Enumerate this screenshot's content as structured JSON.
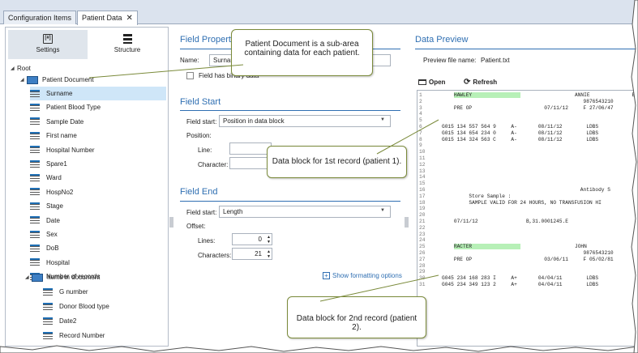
{
  "tabs": [
    {
      "label": "Configuration Items"
    },
    {
      "label": "Patient Data",
      "close": "✕"
    }
  ],
  "left_panel": {
    "settings_label": "Settings",
    "structure_label": "Structure",
    "settings_glyph": "[#]",
    "tree": {
      "root": "Root",
      "patient_document": "Patient Document",
      "patient_fields": [
        "Surname",
        "Patient Blood Type",
        "Sample Date",
        "First name",
        "Hospital Number",
        "Spare1",
        "Ward",
        "HospNo2",
        "Stage",
        "Date",
        "Sex",
        "DoB",
        "Hospital",
        "Number of records"
      ],
      "items_in_document": "Items in document",
      "item_fields": [
        "G number",
        "Donor Blood type",
        "Date2",
        "Record Number"
      ]
    }
  },
  "field_properties": {
    "title": "Field Properties",
    "name_label": "Name:",
    "name_value": "Surname",
    "binary_label": "Field has binary data"
  },
  "field_start": {
    "title": "Field Start",
    "start_label": "Field start:",
    "start_value": "Position in data block",
    "position_label": "Position:",
    "line_label": "Line:",
    "character_label": "Character:"
  },
  "field_end": {
    "title": "Field End",
    "end_label": "Field start:",
    "end_value": "Length",
    "offset_label": "Offset:",
    "lines_label": "Lines:",
    "lines_value": "0",
    "characters_label": "Characters:",
    "characters_value": "21",
    "formatting_link": "Show formatting options"
  },
  "data_preview": {
    "title": "Data Preview",
    "file_label": "Preview file name:",
    "file_value": "Patient.txt",
    "open_label": "Open",
    "refresh_label": "Refresh",
    "lines": [
      {
        "n": "1",
        "t": "    HAWLEY                  ANNIE              ER12345678  A",
        "hl": true
      },
      {
        "n": "2",
        "t": "                                               9876543210"
      },
      {
        "n": "3",
        "t": "    PRE OP                        07/11/12     F 27/06/47"
      },
      {
        "n": "4",
        "t": ""
      },
      {
        "n": "5",
        "t": ""
      },
      {
        "n": "6",
        "t": "G015 134 557 564 9     A-       08/11/12        LDBS"
      },
      {
        "n": "7",
        "t": "G015 134 654 234 0     A-       08/11/12        LDBS"
      },
      {
        "n": "8",
        "t": "G015 134 324 563 C     A-       08/11/12        LDBS"
      },
      {
        "n": "9",
        "t": ""
      },
      {
        "n": "10",
        "t": ""
      },
      {
        "n": "11",
        "t": ""
      },
      {
        "n": "12",
        "t": ""
      },
      {
        "n": "13",
        "t": ""
      },
      {
        "n": "14",
        "t": ""
      },
      {
        "n": "15",
        "t": ""
      },
      {
        "n": "16",
        "t": "                                              Antibody S"
      },
      {
        "n": "17",
        "t": "         Store Sample :"
      },
      {
        "n": "18",
        "t": "         SAMPLE VALID FOR 24 HOURS, NO TRANSFUSION HI"
      },
      {
        "n": "19",
        "t": ""
      },
      {
        "n": "20",
        "t": ""
      },
      {
        "n": "21",
        "t": "    07/11/12                B,31.0001245.E"
      },
      {
        "n": "22",
        "t": ""
      },
      {
        "n": "23",
        "t": ""
      },
      {
        "n": "24",
        "t": ""
      },
      {
        "n": "25",
        "t": "    RACTER                  JOHN               ER12345679",
        "hl2": true
      },
      {
        "n": "26",
        "t": "                                               9876543210"
      },
      {
        "n": "27",
        "t": "    PRE OP                        03/06/11     F 05/02/81"
      },
      {
        "n": "28",
        "t": ""
      },
      {
        "n": "29",
        "t": ""
      },
      {
        "n": "30",
        "t": "G045 234 168 283 I     A+       04/04/11        LDBS"
      },
      {
        "n": "31",
        "t": "G045 234 349 123 2     A+       04/04/11        LDBS"
      }
    ]
  },
  "callouts": {
    "sub_area": "Patient Document is a sub-area containing data for each patient.",
    "block1": "Data block for 1st record (patient 1).",
    "block2": "Data block for 2nd record (patient 2)."
  },
  "colors": {
    "accent": "#2f6fb2",
    "selection": "#cfe6f8",
    "highlight": "#b7f0b7",
    "callout_border": "#7a8a3a"
  }
}
